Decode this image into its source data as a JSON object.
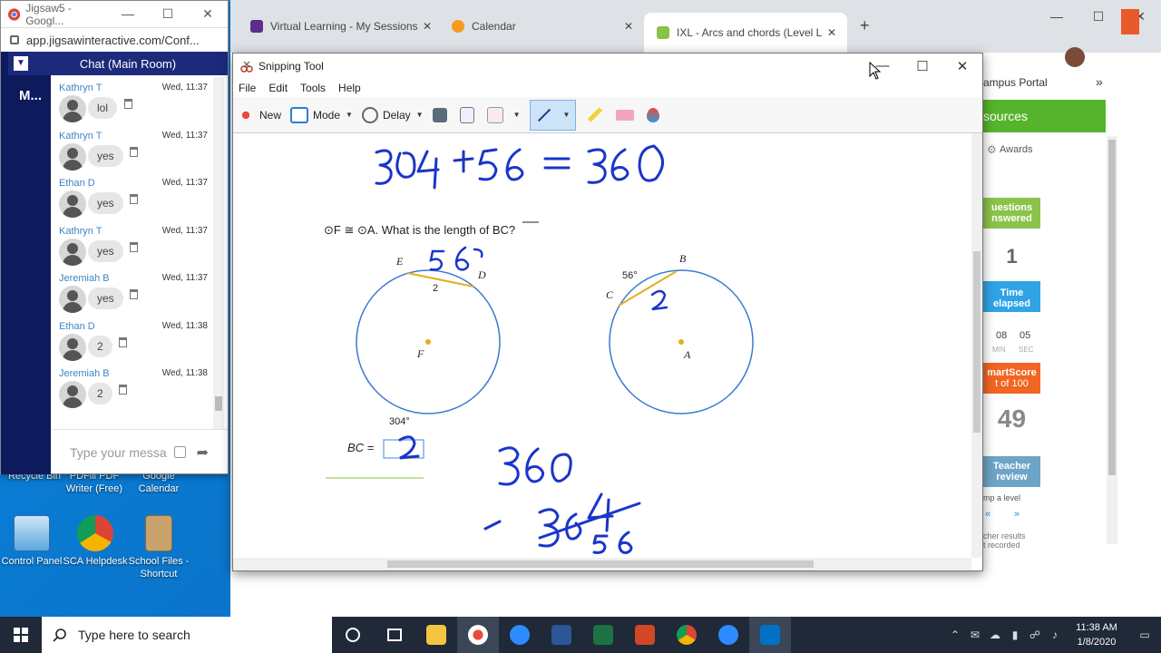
{
  "desktop": {
    "icons": [
      {
        "label": "Recycle Bin"
      },
      {
        "label": "PDFill PDF Writer (Free)"
      },
      {
        "label": "Google Calendar"
      },
      {
        "label": "Control Panel"
      },
      {
        "label": "SCA Helpdesk"
      },
      {
        "label": "School Files - Shortcut"
      }
    ]
  },
  "jigsaw": {
    "title": "Jigsaw5 - Googl...",
    "url": "app.jigsawinteractive.com/Conf...",
    "sidebar_label": "M...",
    "chat_title": "Chat (Main Room)",
    "messages": [
      {
        "user": "Kathryn T",
        "time": "Wed, 11:37",
        "text": "lol"
      },
      {
        "user": "Kathryn T",
        "time": "Wed, 11:37",
        "text": "yes"
      },
      {
        "user": "Ethan D",
        "time": "Wed, 11:37",
        "text": "yes"
      },
      {
        "user": "Kathryn T",
        "time": "Wed, 11:37",
        "text": "yes"
      },
      {
        "user": "Jeremiah B",
        "time": "Wed, 11:37",
        "text": "yes"
      },
      {
        "user": "Ethan D",
        "time": "Wed, 11:38",
        "text": "2"
      },
      {
        "user": "Jeremiah B",
        "time": "Wed, 11:38",
        "text": "2"
      }
    ],
    "input_placeholder": "Type your messa"
  },
  "chrome": {
    "tabs": [
      {
        "label": "Virtual Learning - My Sessions",
        "color": "#5b2d8c"
      },
      {
        "label": "Calendar",
        "color": "#f59b1d"
      },
      {
        "label": "IXL - Arcs and chords (Level L pra",
        "color": "#8bc34a"
      }
    ]
  },
  "ixl": {
    "campus_portal": "ampus Portal",
    "resources": "sources",
    "awards": "Awards",
    "questions_l1": "uestions",
    "questions_l2": "nswered",
    "questions_value": "1",
    "time_l1": "Time",
    "time_l2": "elapsed",
    "time_val_1": "08",
    "time_val_2": "05",
    "time_unit_1": "MIN",
    "time_unit_2": "SEC",
    "smartscore_l1": "martScore",
    "smartscore_l2": "t of 100",
    "smartscore_value": "49",
    "teacher_l1": "Teacher",
    "teacher_l2": "review",
    "jump": "mp a level",
    "results_l1": "cher results",
    "results_l2": "t recorded"
  },
  "snip": {
    "title": "Snipping Tool",
    "menu": [
      "File",
      "Edit",
      "Tools",
      "Help"
    ],
    "toolbar": {
      "new": "New",
      "mode": "Mode",
      "delay": "Delay"
    },
    "question": "⊙F ≅ ⊙A. What is the length of BC?",
    "labels": {
      "E": "E",
      "D": "D",
      "F": "F",
      "two": "2",
      "arc304": "304°",
      "B": "B",
      "C": "C",
      "A": "A",
      "arc56": "56°"
    },
    "answer_label": "BC ="
  },
  "taskbar": {
    "search_placeholder": "Type here to search",
    "time": "11:38 AM",
    "date": "1/8/2020"
  }
}
